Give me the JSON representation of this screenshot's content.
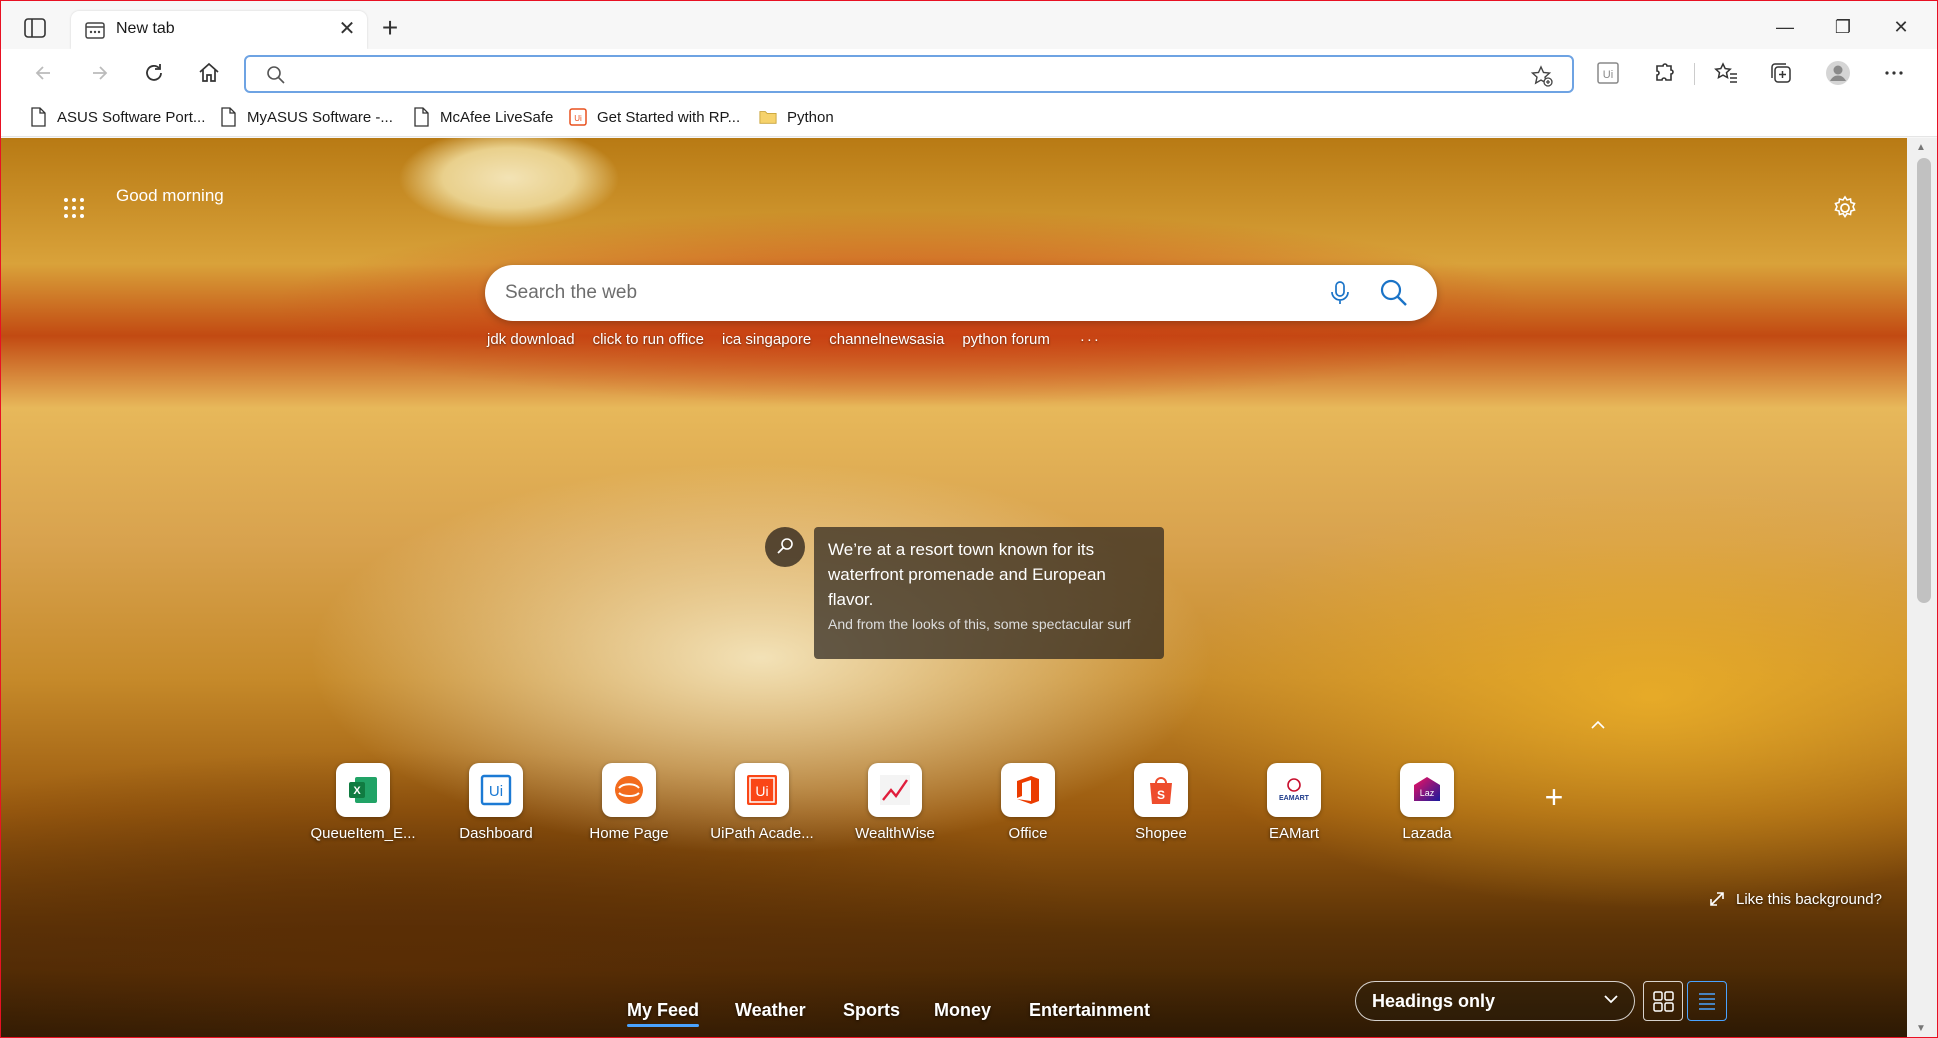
{
  "tab": {
    "title": "New tab",
    "close": "✕"
  },
  "new_tab_symbol": "+",
  "window_controls": {
    "minimize": "—",
    "restore": "❐",
    "close": "✕"
  },
  "address_bar": {
    "value": "",
    "placeholder": ""
  },
  "favorites": [
    {
      "label": "ASUS Software Port...",
      "icon": "page-icon"
    },
    {
      "label": "MyASUS Software -...",
      "icon": "page-icon"
    },
    {
      "label": "McAfee LiveSafe",
      "icon": "page-icon"
    },
    {
      "label": "Get Started with RP...",
      "icon": "uipath-icon"
    },
    {
      "label": "Python",
      "icon": "folder-icon"
    }
  ],
  "greeting": "Good morning",
  "search": {
    "placeholder": "Search the web"
  },
  "trending": [
    "jdk download",
    "click to run office",
    "ica singapore",
    "channelnewsasia",
    "python forum"
  ],
  "trending_more": "···",
  "info_card": {
    "headline": "We’re at a resort town known for its waterfront promenade and European flavor.",
    "subtext": "And from the looks of this, some spectacular surf"
  },
  "quick_links": [
    {
      "label": "QueueItem_E...",
      "icon": "excel-icon"
    },
    {
      "label": "Dashboard",
      "icon": "uipath-blue-icon"
    },
    {
      "label": "Home Page",
      "icon": "homepage-orange-icon"
    },
    {
      "label": "UiPath Acade...",
      "icon": "uipath-orange-icon"
    },
    {
      "label": "WealthWise",
      "icon": "wealthwise-icon"
    },
    {
      "label": "Office",
      "icon": "office-icon"
    },
    {
      "label": "Shopee",
      "icon": "shopee-icon"
    },
    {
      "label": "EAMart",
      "icon": "eamart-icon"
    },
    {
      "label": "Lazada",
      "icon": "lazada-icon"
    }
  ],
  "add_link_symbol": "+",
  "like_background": "Like this background?",
  "feed_tabs": [
    "My Feed",
    "Weather",
    "Sports",
    "Money",
    "Entertainment"
  ],
  "headings_dropdown": "Headings only",
  "tile_text": {
    "excel": "X",
    "uipath": "Ui",
    "office": "O",
    "shopee": "S",
    "eamart": "EAMART",
    "lazada": "Laz"
  },
  "colors": {
    "accent": "#4aa3ff",
    "address_border": "#6ea3e3",
    "window_border": "#e81123"
  }
}
